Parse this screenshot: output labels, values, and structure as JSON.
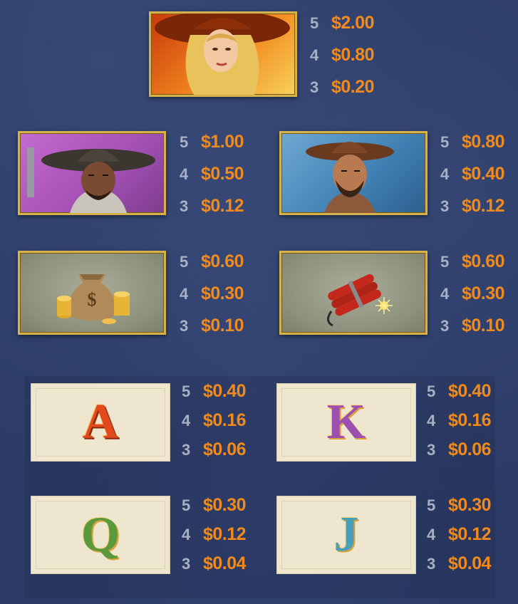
{
  "symbols": [
    {
      "id": "woman",
      "icon": "cowgirl-portrait",
      "pays": [
        {
          "count": "5",
          "value": "$2.00"
        },
        {
          "count": "4",
          "value": "$0.80"
        },
        {
          "count": "3",
          "value": "$0.20"
        }
      ]
    },
    {
      "id": "gunslinger",
      "icon": "gunslinger-portrait",
      "pays": [
        {
          "count": "5",
          "value": "$1.00"
        },
        {
          "count": "4",
          "value": "$0.50"
        },
        {
          "count": "3",
          "value": "$0.12"
        }
      ]
    },
    {
      "id": "cowboy",
      "icon": "cowboy-portrait",
      "pays": [
        {
          "count": "5",
          "value": "$0.80"
        },
        {
          "count": "4",
          "value": "$0.40"
        },
        {
          "count": "3",
          "value": "$0.12"
        }
      ]
    },
    {
      "id": "money",
      "icon": "money-bag",
      "pays": [
        {
          "count": "5",
          "value": "$0.60"
        },
        {
          "count": "4",
          "value": "$0.30"
        },
        {
          "count": "3",
          "value": "$0.10"
        }
      ]
    },
    {
      "id": "dynamite",
      "icon": "dynamite",
      "pays": [
        {
          "count": "5",
          "value": "$0.60"
        },
        {
          "count": "4",
          "value": "$0.30"
        },
        {
          "count": "3",
          "value": "$0.10"
        }
      ]
    },
    {
      "id": "a",
      "letter": "A",
      "color": "#e24a1e",
      "pays": [
        {
          "count": "5",
          "value": "$0.40"
        },
        {
          "count": "4",
          "value": "$0.16"
        },
        {
          "count": "3",
          "value": "$0.06"
        }
      ]
    },
    {
      "id": "k",
      "letter": "K",
      "color": "#9c4fb0",
      "pays": [
        {
          "count": "5",
          "value": "$0.40"
        },
        {
          "count": "4",
          "value": "$0.16"
        },
        {
          "count": "3",
          "value": "$0.06"
        }
      ]
    },
    {
      "id": "q",
      "letter": "Q",
      "color": "#5a9a3c",
      "pays": [
        {
          "count": "5",
          "value": "$0.30"
        },
        {
          "count": "4",
          "value": "$0.12"
        },
        {
          "count": "3",
          "value": "$0.04"
        }
      ]
    },
    {
      "id": "j",
      "letter": "J",
      "color": "#4a9fb8",
      "pays": [
        {
          "count": "5",
          "value": "$0.30"
        },
        {
          "count": "4",
          "value": "$0.12"
        },
        {
          "count": "3",
          "value": "$0.04"
        }
      ]
    }
  ]
}
